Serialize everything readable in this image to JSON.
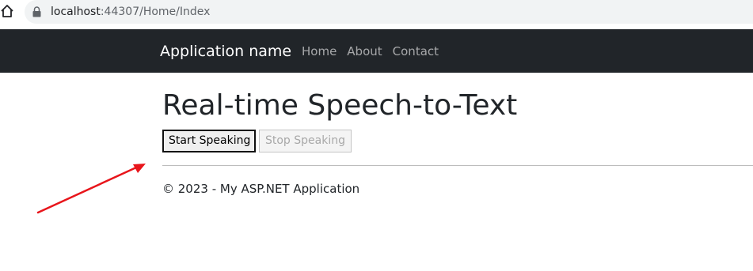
{
  "browser": {
    "url_host": "localhost",
    "url_port": ":44307",
    "url_path": "/Home/Index",
    "icons": {
      "home": "home-icon",
      "lock": "lock-icon"
    }
  },
  "navbar": {
    "brand": "Application name",
    "links": [
      "Home",
      "About",
      "Contact"
    ],
    "background": "#212529"
  },
  "main": {
    "title": "Real-time Speech-to-Text",
    "start_button": "Start Speaking",
    "stop_button": "Stop Speaking",
    "stop_button_disabled": true
  },
  "footer": {
    "text": "© 2023 - My ASP.NET Application"
  },
  "annotation": {
    "type": "arrow",
    "color": "#e8151b"
  }
}
